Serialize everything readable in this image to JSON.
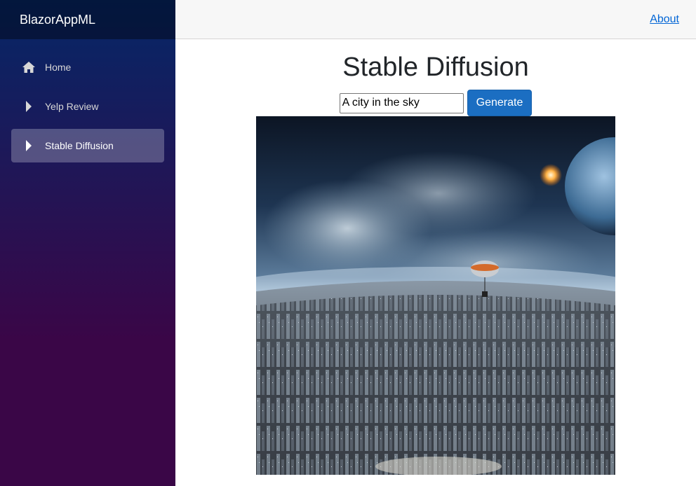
{
  "sidebar": {
    "brand": "BlazorAppML",
    "items": [
      {
        "label": "Home",
        "icon": "home-icon",
        "active": false
      },
      {
        "label": "Yelp Review",
        "icon": "caret-right-icon",
        "active": false
      },
      {
        "label": "Stable Diffusion",
        "icon": "caret-right-icon",
        "active": true
      }
    ]
  },
  "header": {
    "about_label": "About"
  },
  "main": {
    "title": "Stable Diffusion",
    "prompt_value": "A city in the sky",
    "generate_label": "Generate"
  },
  "colors": {
    "sidebar_top": "#052767",
    "sidebar_bottom": "#3a0647",
    "accent_button": "#1b6ec2",
    "link": "#0366d6"
  }
}
